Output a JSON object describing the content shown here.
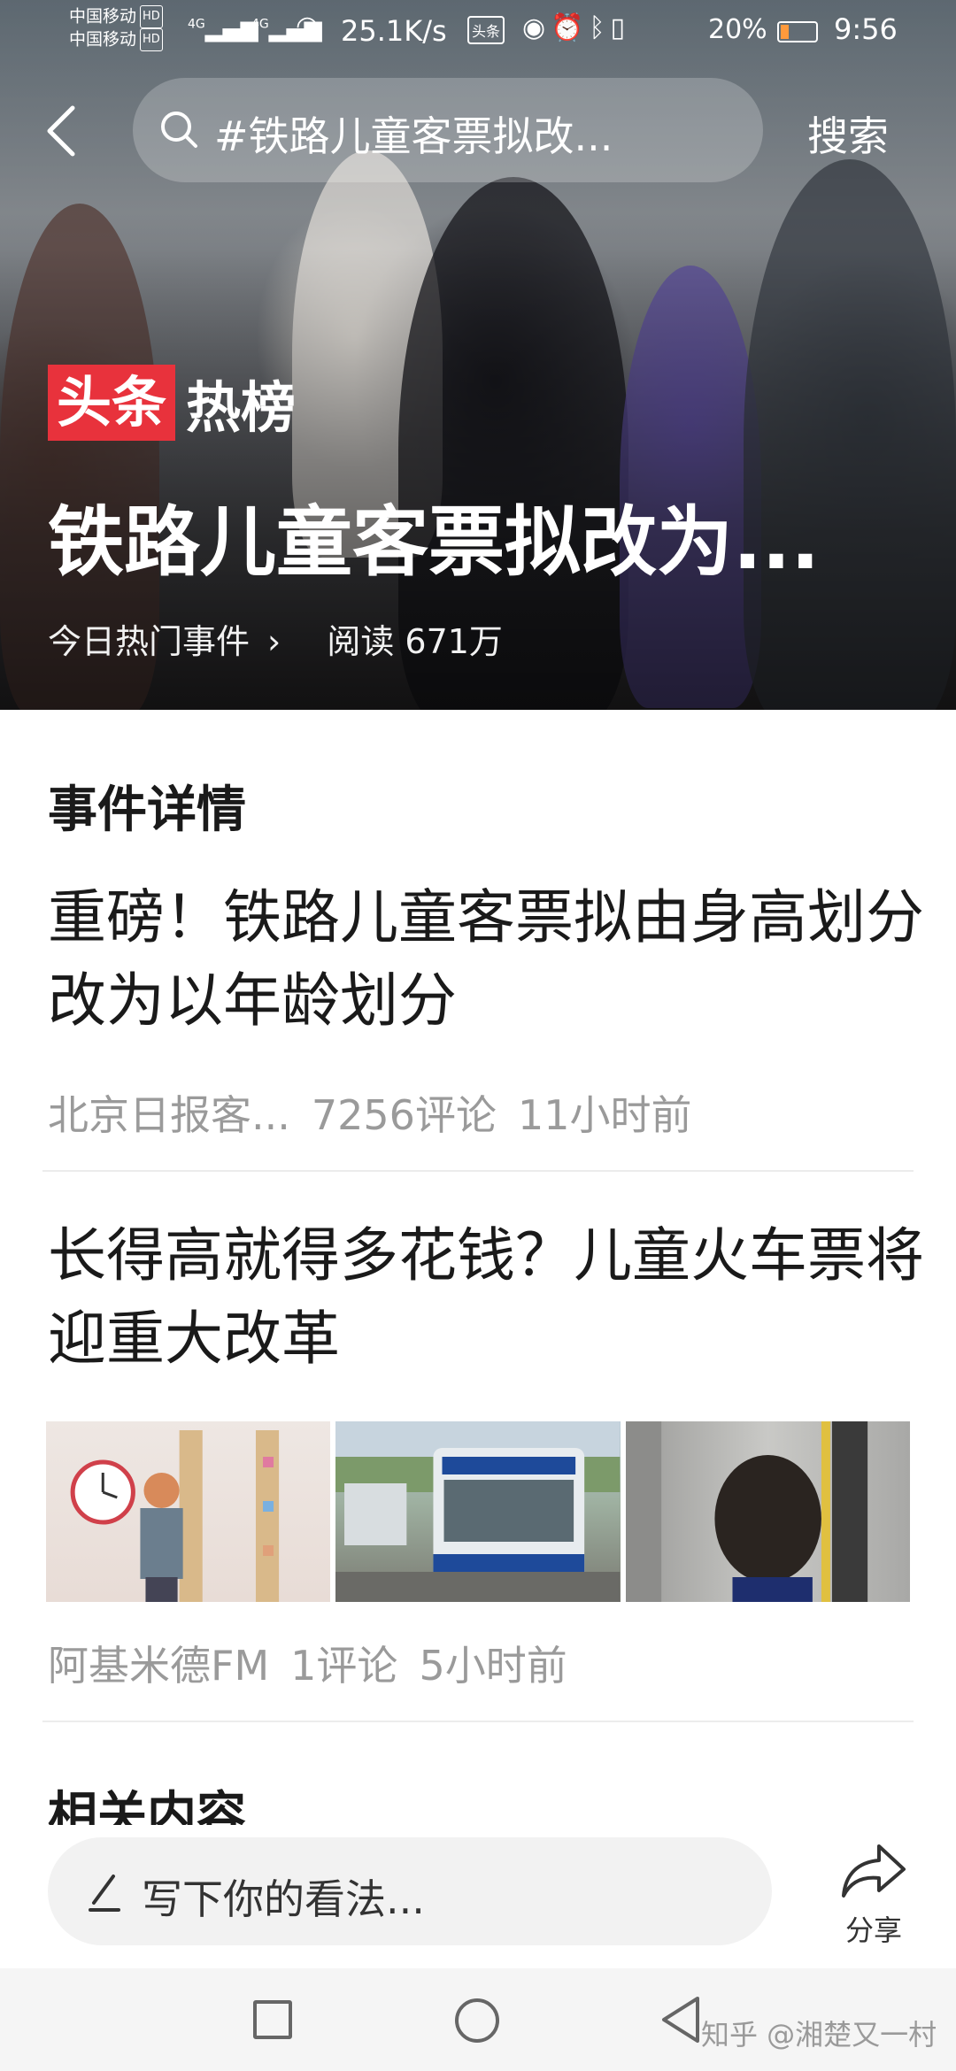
{
  "status_bar": {
    "carrier1": "中国移动",
    "carrier2": "中国移动",
    "hd1": "HD",
    "hd2": "HD",
    "net1": "4G",
    "net2": "4G",
    "speed": "25.1K/s",
    "app_badge": "头条",
    "battery_pct": "20%",
    "time": "9:56"
  },
  "top_bar": {
    "search_text": "#铁路儿童客票拟改...",
    "search_button": "搜索"
  },
  "hero": {
    "brand_red": "头条",
    "brand_text": "热榜",
    "headline": "铁路儿童客票拟改为...",
    "category": "今日热门事件",
    "category_arrow": "›",
    "reads": "阅读 671万"
  },
  "content": {
    "section_title": "事件详情",
    "articles": [
      {
        "title": "重磅！铁路儿童客票拟由身高划分改为以年龄划分",
        "source": "北京日报客...",
        "comments": "7256评论",
        "time": "11小时前"
      },
      {
        "title": "长得高就得多花钱？儿童火车票将迎重大改革",
        "source": "阿基米德FM",
        "comments": "1评论",
        "time": "5小时前"
      }
    ],
    "next_section_title": "相关内容"
  },
  "bottom_bar": {
    "comment_placeholder": "写下你的看法...",
    "share_label": "分享"
  },
  "nav_bar": {
    "watermark": "知乎 @湘楚又一村"
  },
  "colors": {
    "brand_red": "#e8323c",
    "meta_gray": "#9a9a9a"
  }
}
